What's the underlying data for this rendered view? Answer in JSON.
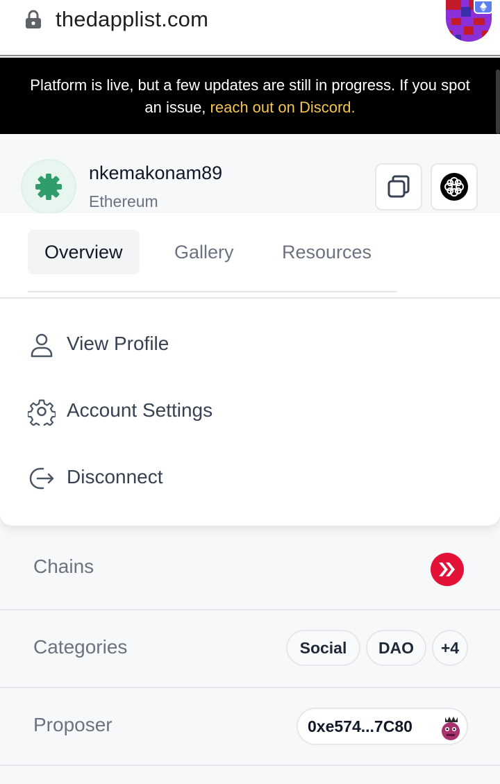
{
  "browser": {
    "url": "thedapplist.com",
    "lock_icon": "lock-icon"
  },
  "banner": {
    "text": "Platform is live, but a few updates are still in progress. If you spot an issue, ",
    "link_text": "reach out on Discord."
  },
  "profile": {
    "username": "nkemakonam89",
    "chain": "Ethereum"
  },
  "tabs": [
    {
      "label": "Overview",
      "active": true
    },
    {
      "label": "Gallery",
      "active": false
    },
    {
      "label": "Resources",
      "active": false
    }
  ],
  "menu": [
    {
      "label": "View Profile",
      "icon": "user-icon"
    },
    {
      "label": "Account Settings",
      "icon": "gear-icon"
    },
    {
      "label": "Disconnect",
      "icon": "logout-icon"
    }
  ],
  "details": {
    "chains_label": "Chains",
    "categories_label": "Categories",
    "categories": [
      "Social",
      "DAO",
      "+4"
    ],
    "proposer_label": "Proposer",
    "proposer_address": "0xe574...7C80"
  },
  "colors": {
    "banner_link": "#f5c451",
    "hive_red": "#e31337",
    "avatar_green": "#2f9e6b"
  }
}
